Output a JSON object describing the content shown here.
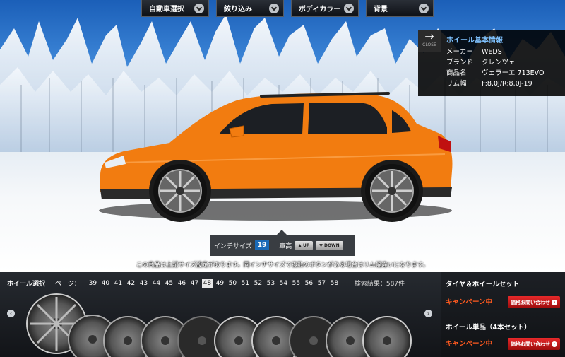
{
  "menu": {
    "items": [
      {
        "label": "自動車選択"
      },
      {
        "label": "絞り込み"
      },
      {
        "label": "ボディカラー"
      },
      {
        "label": "背景"
      }
    ]
  },
  "info_panel": {
    "close_label": "CLOSE",
    "title": "ホイール基本情報",
    "rows": [
      {
        "key": "メーカー",
        "value": "WEDS"
      },
      {
        "key": "ブランド",
        "value": "クレンツェ"
      },
      {
        "key": "商品名",
        "value": "ヴェラーエ 713EVO"
      },
      {
        "key": "リム幅",
        "value": "F:8.0J/R:8.0J-19"
      }
    ]
  },
  "size_control": {
    "inch_label": "インチサイズ",
    "inch_value": "19",
    "height_label": "車高",
    "up_label": "▲ UP",
    "down_label": "▼ DOWN"
  },
  "notice": "この商品は上記サイズ設定があります。同インチサイズで複数のボタンがある場合はリム幅違いになります。",
  "wheel_selector": {
    "label": "ホイール選択",
    "page_label": "ページ：",
    "pages": [
      "39",
      "40",
      "41",
      "42",
      "43",
      "44",
      "45",
      "46",
      "47",
      "48",
      "49",
      "50",
      "51",
      "52",
      "53",
      "54",
      "55",
      "56",
      "57",
      "58"
    ],
    "active_page": "48",
    "result": "検索結果：587件"
  },
  "sidebar": {
    "set_title": "タイヤ＆ホイールセット",
    "set_campaign": "キャンペーン中",
    "set_price_button": "価格お問い合わせ",
    "single_title": "ホイール単品（4本セット）",
    "single_campaign": "キャンペーン中",
    "single_price_button": "価格お問い合わせ"
  },
  "colors": {
    "car_body": "#f27c10",
    "accent_blue": "#1a6ab8",
    "campaign_orange": "#ff5a1f",
    "price_red": "#d81f20"
  }
}
